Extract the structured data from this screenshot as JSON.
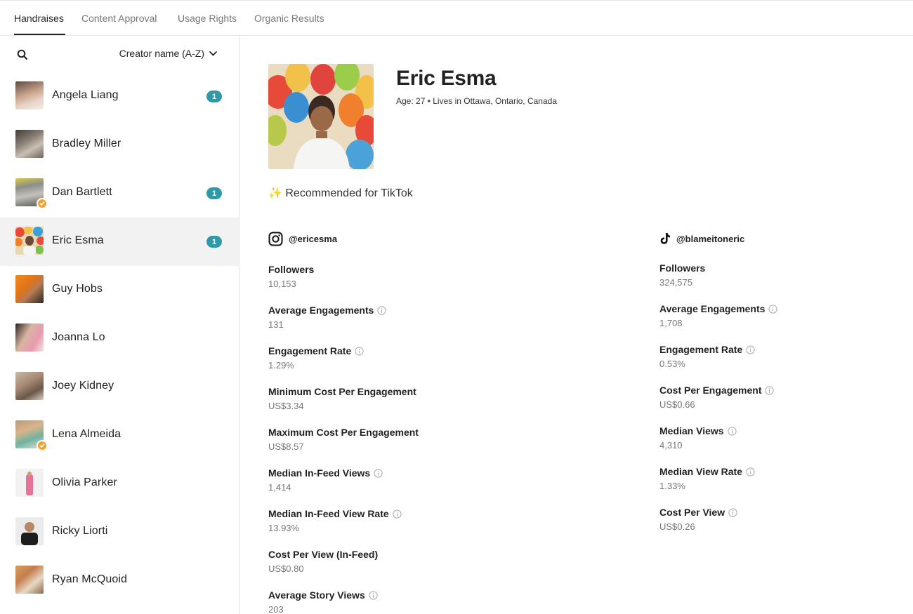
{
  "tabs": [
    {
      "label": "Handraises",
      "active": true
    },
    {
      "label": "Content Approval"
    },
    {
      "label": "Usage Rights"
    },
    {
      "label": "Organic Results"
    }
  ],
  "sidebar": {
    "sort_label": "Creator name (A-Z)",
    "creators": [
      {
        "name": "Angela Liang",
        "badge": "1"
      },
      {
        "name": "Bradley Miller",
        "badge": ""
      },
      {
        "name": "Dan Bartlett",
        "badge": "1",
        "verified": true
      },
      {
        "name": "Eric Esma",
        "badge": "1",
        "selected": true
      },
      {
        "name": "Guy Hobs",
        "badge": ""
      },
      {
        "name": "Joanna Lo",
        "badge": ""
      },
      {
        "name": "Joey Kidney",
        "badge": ""
      },
      {
        "name": "Lena Almeida",
        "badge": "",
        "verified": true
      },
      {
        "name": "Olivia Parker",
        "badge": ""
      },
      {
        "name": "Ricky Liorti",
        "badge": ""
      },
      {
        "name": "Ryan McQuoid",
        "badge": ""
      }
    ]
  },
  "profile": {
    "name": "Eric Esma",
    "meta": "Age: 27 • Lives in Ottawa, Ontario, Canada",
    "recommendation": "✨ Recommended for TikTok"
  },
  "instagram": {
    "handle": "@ericesma",
    "metrics": [
      {
        "label": "Followers",
        "value": "10,153",
        "info": false
      },
      {
        "label": "Average Engagements",
        "value": "131",
        "info": true
      },
      {
        "label": "Engagement Rate",
        "value": "1.29%",
        "info": true
      },
      {
        "label": "Minimum Cost Per Engagement",
        "value": "US$3.34",
        "info": false
      },
      {
        "label": "Maximum Cost Per Engagement",
        "value": "US$8.57",
        "info": false
      },
      {
        "label": "Median In-Feed Views",
        "value": "1,414",
        "info": true
      },
      {
        "label": "Median In-Feed View Rate",
        "value": "13.93%",
        "info": true
      },
      {
        "label": "Cost Per View (In-Feed)",
        "value": "US$0.80",
        "info": false
      },
      {
        "label": "Average Story Views",
        "value": "203",
        "info": true
      }
    ]
  },
  "tiktok": {
    "handle": "@blameitoneric",
    "metrics": [
      {
        "label": "Followers",
        "value": "324,575",
        "info": false
      },
      {
        "label": "Average Engagements",
        "value": "1,708",
        "info": true
      },
      {
        "label": "Engagement Rate",
        "value": "0.53%",
        "info": true
      },
      {
        "label": "Cost Per Engagement",
        "value": "US$0.66",
        "info": true
      },
      {
        "label": "Median Views",
        "value": "4,310",
        "info": true
      },
      {
        "label": "Median View Rate",
        "value": "1.33%",
        "info": true
      },
      {
        "label": "Cost Per View",
        "value": "US$0.26",
        "info": true
      }
    ]
  },
  "colors": {
    "badge": "#2f9aa5",
    "verified": "#f0a22e",
    "selected_row": "#f2f2f2"
  },
  "icons": {
    "search": "search-icon",
    "sort": "chevron-down-icon",
    "info": "info-icon",
    "instagram": "instagram-icon",
    "tiktok": "tiktok-icon"
  }
}
